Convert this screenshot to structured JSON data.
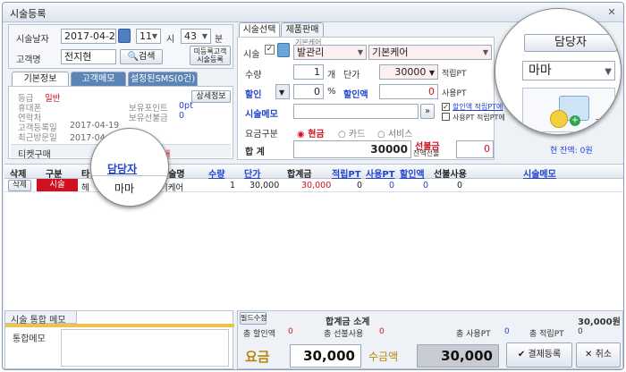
{
  "window": {
    "title": "시술등록",
    "close": "✕"
  },
  "customer": {
    "date_label": "시술날자",
    "date_value": "2017-04-20",
    "hour_value": "11",
    "hour_unit": "시",
    "minute_value": "43",
    "minute_unit": "분",
    "name_label": "고객명",
    "name_value": "전지현",
    "search_button": "검색",
    "unregistered_button_line1": "미등록고객",
    "unregistered_button_line2": "시술등록"
  },
  "left_tabs": [
    "기본정보",
    "고객메모",
    "설정된SMS(0건)"
  ],
  "basic_info": {
    "detail_button": "상세정보",
    "grade_label": "등급",
    "grade_value": "일반",
    "mobile_label": "휴대폰",
    "contact_label": "연락처",
    "reg_date_label": "고객등록일",
    "reg_date_value": "2017-04-19",
    "last_visit_label": "최근방문일",
    "last_visit_value": "2017-04-19(오늘)",
    "points_label": "보유포인트",
    "points_value": "0pt",
    "prepaid_label": "보유선불금",
    "prepaid_value": "0",
    "ticket_label": "티켓구매",
    "ticket_extra": "구매"
  },
  "right_tabs": [
    "시술선택",
    "제품판매"
  ],
  "service": {
    "service_label": "시술",
    "category_caption": "기본케어",
    "category_value": "발관리",
    "item_value": "기본케어",
    "qty_label": "수량",
    "qty_value": "1",
    "qty_unit": "개",
    "price_label": "단가",
    "price_value": "30000",
    "points_earned_label": "적립PT",
    "points_earned_value": "0",
    "discount_label": "할인",
    "discount_pct": "0",
    "pct_unit": "%",
    "discount_amount_label": "할인액",
    "discount_amount_value": "0",
    "points_used_label": "사용PT",
    "memo_label": "시술메모",
    "memo_btn": "»",
    "chk_discount_points": "할인액 적립PT에",
    "chk_used_points": "사용PT 적립PT에",
    "payment_label": "요금구분",
    "payment_options": [
      "현금",
      "카드",
      "서비스"
    ],
    "total_label": "합 계",
    "total_value": "30000",
    "prepaid_label": "선불금",
    "prepaid_sub": "잔액선불",
    "prepaid_value": "0",
    "balance_text": "현 잔액: 0원"
  },
  "staff": {
    "title": "담당자",
    "selected": "마마",
    "icon_text": "기"
  },
  "grid": {
    "headers": [
      "삭제",
      "구분",
      "타",
      "담당자",
      "시술명",
      "수량",
      "단가",
      "합계금",
      "적립PT",
      "사용PT",
      "할인액",
      "선불사용",
      "시술메모"
    ],
    "row": {
      "delete": "삭제",
      "type": "시술",
      "type_abbr": "헤",
      "staff": "마마",
      "name": "기케어",
      "qty": "1",
      "price": "30,000",
      "total": "30,000",
      "points_earned": "0",
      "points_used": "0",
      "discount": "0",
      "prepaid_used": "0"
    }
  },
  "memo_panel": {
    "title": "시술 통합 메모",
    "label": "통합메모"
  },
  "summary": {
    "field_edit": "필드수정",
    "subtotal_label": "합계금 소계",
    "subtotal_value": "30,000원",
    "discount_label": "총 할인액",
    "discount_value": "0",
    "prepaid_label": "총 선불사용",
    "prepaid_value": "0",
    "used_pt_label": "총 사용PT",
    "used_pt_value": "0",
    "earned_pt_label": "총 적립PT",
    "earned_pt_value": "0",
    "fee_label": "요금",
    "fee_value": "30,000",
    "collect_label": "수금액",
    "collect_value": "30,000",
    "register_button": "결제등록",
    "cancel_button": "취소"
  },
  "colors": {
    "accent_red": "#d01020",
    "link_blue": "#2244cc",
    "tab_blue": "#5b85b7"
  }
}
